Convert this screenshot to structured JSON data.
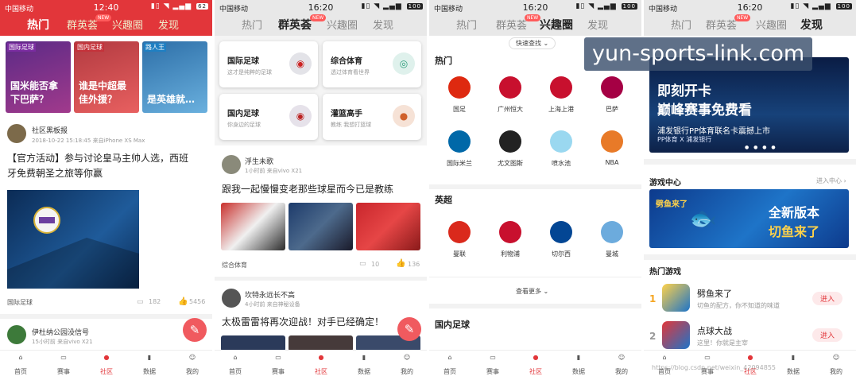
{
  "common": {
    "carrier": "中国移动",
    "new_badge": "NEW",
    "tabs": [
      "热门",
      "群英荟",
      "兴趣圈",
      "发现"
    ],
    "bottom_nav": [
      "首页",
      "赛事",
      "社区",
      "数据",
      "我的"
    ]
  },
  "screens": [
    {
      "time": "12:40",
      "battery": "62",
      "active_tab": "热门",
      "banners": [
        {
          "tag": "国际足球",
          "title_l1": "国米能否拿",
          "title_l2": "下巴萨？"
        },
        {
          "tag": "国内足球",
          "title_l1": "谁是中超最",
          "title_l2": "佳外援？"
        },
        {
          "tag": "路人王",
          "title_l1": "",
          "title_l2": "是英雄就…"
        }
      ],
      "post1": {
        "author": "社区黑板报",
        "meta": "2018-10-22 15:18:45  来自iPhone XS Max",
        "title_l1": "【官方活动】参与讨论皇马主帅人选，西班",
        "title_l2": "牙免费朝圣之旅等你赢",
        "category": "国际足球",
        "comments": "182",
        "likes": "5456"
      },
      "post2": {
        "author": "伊杜纳公园没信号",
        "meta": "15小时前  来自vivo X21"
      }
    },
    {
      "time": "16:20",
      "battery": "100",
      "active_tab": "群英荟",
      "circles": [
        {
          "name": "国际足球",
          "desc": "这才是纯粹的足球"
        },
        {
          "name": "综合体育",
          "desc": "透过体育看世界"
        },
        {
          "name": "国内足球",
          "desc": "你身边的足球"
        },
        {
          "name": "灌篮高手",
          "desc": "教练 我想打篮球"
        }
      ],
      "post1": {
        "author": "浮生未歌",
        "meta": "1小时前  来自vivo X21",
        "title": "跟我一起慢慢变老那些球星而今已是教练",
        "category": "综合体育",
        "comments": "10",
        "likes": "136"
      },
      "post2": {
        "author": "坎特永远长不高",
        "meta": "4小时前  来自神秘设备",
        "title": "太极雷雷将再次迎战！对手已经确定！"
      }
    },
    {
      "time": "16:20",
      "battery": "100",
      "active_tab": "兴趣圈",
      "quick_find": "快速查找",
      "sections": [
        {
          "title": "热门",
          "teams": [
            "国足",
            "广州恒大",
            "上海上港",
            "巴萨",
            "国际米兰",
            "尤文图斯",
            "喷水池",
            "NBA"
          ]
        },
        {
          "title": "英超",
          "teams": [
            "曼联",
            "利物浦",
            "切尔西",
            "曼城"
          ]
        }
      ],
      "more": "查看更多",
      "next_section": "国内足球"
    },
    {
      "time": "16:20",
      "battery": "100",
      "active_tab": "发现",
      "banner": {
        "l1": "即刻开卡",
        "l2": "巅峰赛事免费看",
        "l3": "浦发银行PP体育联名卡震撼上市",
        "l4": "PP体育 X 浦发银行"
      },
      "game_center": "游戏中心",
      "enter_center": "进入中心",
      "game_banner": {
        "logo": "劈鱼来了",
        "l1": "全新版本",
        "l2": "切鱼来了"
      },
      "hot_games_title": "热门游戏",
      "games": [
        {
          "rank": "1",
          "name": "劈鱼来了",
          "desc": "切鱼的配方，你不知道的味道",
          "btn": "进入"
        },
        {
          "rank": "2",
          "name": "点球大战",
          "desc": "这里！你就是主宰",
          "btn": "进入"
        }
      ]
    }
  ],
  "watermark": "yun-sports-link.com",
  "footer_watermark": "https://blog.csdn.net/weixin_42094855",
  "colors": {
    "brand_red": "#e2363a",
    "badge_red": "#ff5b5b",
    "rank_orange": "#f5a623"
  }
}
